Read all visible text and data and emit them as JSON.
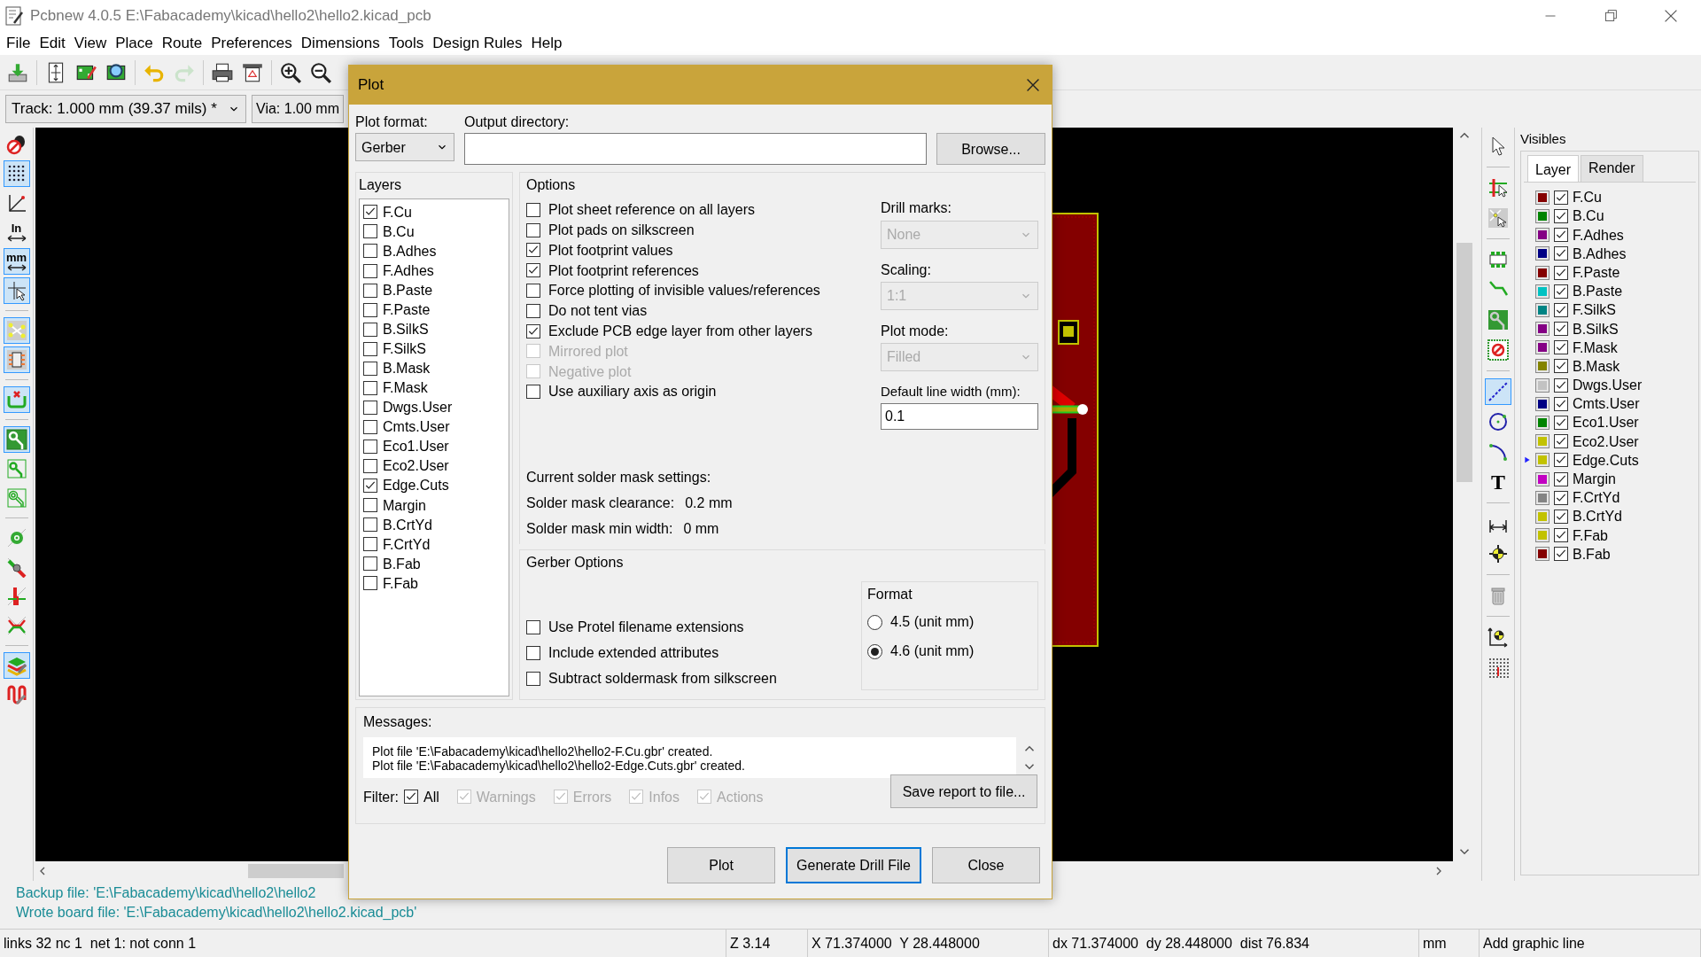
{
  "window": {
    "title": "Pcbnew 4.0.5 E:\\Fabacademy\\kicad\\hello2\\hello2.kicad_pcb"
  },
  "menu": [
    {
      "label": "File"
    },
    {
      "label": "Edit"
    },
    {
      "label": "View"
    },
    {
      "label": "Place"
    },
    {
      "label": "Route"
    },
    {
      "label": "Preferences"
    },
    {
      "label": "Dimensions"
    },
    {
      "label": "Tools"
    },
    {
      "label": "Design Rules"
    },
    {
      "label": "Help"
    }
  ],
  "toolbar": [
    {
      "disabled": false
    },
    {
      "disabled": false
    },
    {
      "disabled": false
    },
    {
      "disabled": false
    },
    {
      "disabled": false
    },
    {
      "disabled": true
    },
    {
      "disabled": false
    },
    {
      "disabled": false
    },
    {
      "disabled": false
    },
    {
      "disabled": false
    }
  ],
  "track_width": {
    "value": "Track: 1.000 mm (39.37 mils) *"
  },
  "via_size": {
    "value": "Via: 1.00 mm"
  },
  "left_toolbar": [
    {
      "selected": false
    },
    {
      "selected": true
    },
    {
      "selected": false
    },
    {
      "selected": false,
      "label": "In"
    },
    {
      "selected": true,
      "label": "mm"
    },
    {
      "selected": true
    },
    {
      "selected": true
    },
    {
      "selected": true
    },
    {
      "selected": true
    },
    {
      "selected": true
    },
    {
      "selected": false
    },
    {
      "selected": false
    },
    {
      "selected": false
    },
    {
      "selected": false
    },
    {
      "selected": false
    },
    {
      "selected": false
    },
    {
      "selected": true
    },
    {
      "selected": false
    }
  ],
  "right_toolbar": [
    {
      "selected": false
    },
    {
      "selected": false
    },
    {
      "selected": false
    },
    {
      "selected": false
    },
    {
      "selected": false
    },
    {
      "selected": false
    },
    {
      "selected": false
    },
    {
      "selected": true
    },
    {
      "selected": false
    },
    {
      "selected": false
    },
    {
      "selected": false,
      "label": "T"
    },
    {
      "selected": false
    },
    {
      "selected": false
    },
    {
      "selected": false
    },
    {
      "selected": false
    },
    {
      "selected": false
    }
  ],
  "visibles": {
    "title": "Visibles",
    "tabs": [
      {
        "label": "Layer",
        "selected": true
      },
      {
        "label": "Render",
        "selected": false
      }
    ],
    "layers": [
      {
        "name": "F.Cu",
        "color": "#840000",
        "checked": true,
        "selected": false
      },
      {
        "name": "B.Cu",
        "color": "#008400",
        "checked": true,
        "selected": false
      },
      {
        "name": "F.Adhes",
        "color": "#840084",
        "checked": true,
        "selected": false
      },
      {
        "name": "B.Adhes",
        "color": "#000084",
        "checked": true,
        "selected": false
      },
      {
        "name": "F.Paste",
        "color": "#840000",
        "checked": true,
        "selected": false
      },
      {
        "name": "B.Paste",
        "color": "#00c2c2",
        "checked": true,
        "selected": false
      },
      {
        "name": "F.SilkS",
        "color": "#008484",
        "checked": true,
        "selected": false
      },
      {
        "name": "B.SilkS",
        "color": "#840084",
        "checked": true,
        "selected": false
      },
      {
        "name": "F.Mask",
        "color": "#840084",
        "checked": true,
        "selected": false
      },
      {
        "name": "B.Mask",
        "color": "#848400",
        "checked": true,
        "selected": false
      },
      {
        "name": "Dwgs.User",
        "color": "#c2c2c2",
        "checked": true,
        "selected": false
      },
      {
        "name": "Cmts.User",
        "color": "#000084",
        "checked": true,
        "selected": false
      },
      {
        "name": "Eco1.User",
        "color": "#008400",
        "checked": true,
        "selected": false
      },
      {
        "name": "Eco2.User",
        "color": "#c2c200",
        "checked": true,
        "selected": false
      },
      {
        "name": "Edge.Cuts",
        "color": "#c2c200",
        "checked": true,
        "selected": true
      },
      {
        "name": "Margin",
        "color": "#c200c2",
        "checked": true,
        "selected": false
      },
      {
        "name": "F.CrtYd",
        "color": "#848484",
        "checked": true,
        "selected": false
      },
      {
        "name": "B.CrtYd",
        "color": "#c2c200",
        "checked": true,
        "selected": false
      },
      {
        "name": "F.Fab",
        "color": "#c2c200",
        "checked": true,
        "selected": false
      },
      {
        "name": "B.Fab",
        "color": "#840000",
        "checked": true,
        "selected": false
      }
    ]
  },
  "messages": [
    "Backup file: 'E:\\Fabacademy\\kicad\\hello2\\hello2",
    "Wrote board file: 'E:\\Fabacademy\\kicad\\hello2\\hello2.kicad_pcb'"
  ],
  "status_bar": [
    "links 32 nc 1  net 1: not conn 1",
    "Z 3.14",
    "X 71.374000  Y 28.448000",
    "dx 71.374000  dy 28.448000  dist 76.834",
    "mm",
    "Add graphic line"
  ],
  "plot_dialog": {
    "title": "Plot",
    "plot_format": {
      "label": "Plot format:",
      "value": "Gerber"
    },
    "output_directory": {
      "label": "Output directory:"
    },
    "browse_button": "Browse...",
    "layers": {
      "title": "Layers",
      "items": [
        {
          "name": "F.Cu",
          "checked": true
        },
        {
          "name": "B.Cu",
          "checked": false
        },
        {
          "name": "B.Adhes",
          "checked": false
        },
        {
          "name": "F.Adhes",
          "checked": false
        },
        {
          "name": "B.Paste",
          "checked": false
        },
        {
          "name": "F.Paste",
          "checked": false
        },
        {
          "name": "B.SilkS",
          "checked": false
        },
        {
          "name": "F.SilkS",
          "checked": false
        },
        {
          "name": "B.Mask",
          "checked": false
        },
        {
          "name": "F.Mask",
          "checked": false
        },
        {
          "name": "Dwgs.User",
          "checked": false
        },
        {
          "name": "Cmts.User",
          "checked": false
        },
        {
          "name": "Eco1.User",
          "checked": false
        },
        {
          "name": "Eco2.User",
          "checked": false
        },
        {
          "name": "Edge.Cuts",
          "checked": true
        },
        {
          "name": "Margin",
          "checked": false
        },
        {
          "name": "B.CrtYd",
          "checked": false
        },
        {
          "name": "F.CrtYd",
          "checked": false
        },
        {
          "name": "B.Fab",
          "checked": false
        },
        {
          "name": "F.Fab",
          "checked": false
        }
      ]
    },
    "options": {
      "title": "Options",
      "checkboxes": [
        {
          "label": "Plot sheet reference on all layers",
          "checked": false,
          "disabled": false
        },
        {
          "label": "Plot pads on silkscreen",
          "checked": false,
          "disabled": false
        },
        {
          "label": "Plot footprint values",
          "checked": true,
          "disabled": false
        },
        {
          "label": "Plot footprint references",
          "checked": true,
          "disabled": false
        },
        {
          "label": "Force plotting of invisible values/references",
          "checked": false,
          "disabled": false
        },
        {
          "label": "Do not tent vias",
          "checked": false,
          "disabled": false
        },
        {
          "label": "Exclude PCB edge layer from other layers",
          "checked": true,
          "disabled": false
        },
        {
          "label": "Mirrored plot",
          "checked": false,
          "disabled": true
        },
        {
          "label": "Negative plot",
          "checked": false,
          "disabled": true
        },
        {
          "label": "Use auxiliary axis as origin",
          "checked": false,
          "disabled": false
        }
      ],
      "selects": [
        {
          "label": "Drill marks:",
          "value": "None",
          "disabled": true
        },
        {
          "label": "Scaling:",
          "value": "1:1",
          "disabled": true
        },
        {
          "label": "Plot mode:",
          "value": "Filled",
          "disabled": true
        }
      ],
      "line_width": {
        "label": "Default line width (mm):",
        "value": "0.1"
      }
    },
    "solder_mask": {
      "title": "Current solder mask settings:",
      "rows": [
        {
          "label": "Solder mask clearance:",
          "value": "0.2 mm"
        },
        {
          "label": "Solder mask min width:",
          "value": "0 mm"
        }
      ]
    },
    "gerber_options": {
      "title": "Gerber Options",
      "checkboxes": [
        {
          "label": "Use Protel filename extensions",
          "checked": false
        },
        {
          "label": "Include extended attributes",
          "checked": false
        },
        {
          "label": "Subtract soldermask from silkscreen",
          "checked": false
        }
      ],
      "format": {
        "title": "Format",
        "options": [
          {
            "label": "4.5 (unit mm)",
            "selected": false
          },
          {
            "label": "4.6 (unit mm)",
            "selected": true
          }
        ]
      }
    },
    "messages": {
      "title": "Messages:",
      "lines": [
        "Plot file 'E:\\Fabacademy\\kicad\\hello2\\hello2-F.Cu.gbr' created.",
        "Plot file 'E:\\Fabacademy\\kicad\\hello2\\hello2-Edge.Cuts.gbr' created."
      ],
      "filter_label": "Filter:",
      "filters": [
        {
          "label": "All",
          "checked": true,
          "disabled": false
        },
        {
          "label": "Warnings",
          "checked": true,
          "disabled": true
        },
        {
          "label": "Errors",
          "checked": true,
          "disabled": true
        },
        {
          "label": "Infos",
          "checked": true,
          "disabled": true
        },
        {
          "label": "Actions",
          "checked": true,
          "disabled": true
        }
      ],
      "save_button": "Save report to file..."
    },
    "buttons": [
      {
        "label": "Plot",
        "focused": false
      },
      {
        "label": "Generate Drill File",
        "focused": true
      },
      {
        "label": "Close",
        "focused": false
      }
    ]
  }
}
